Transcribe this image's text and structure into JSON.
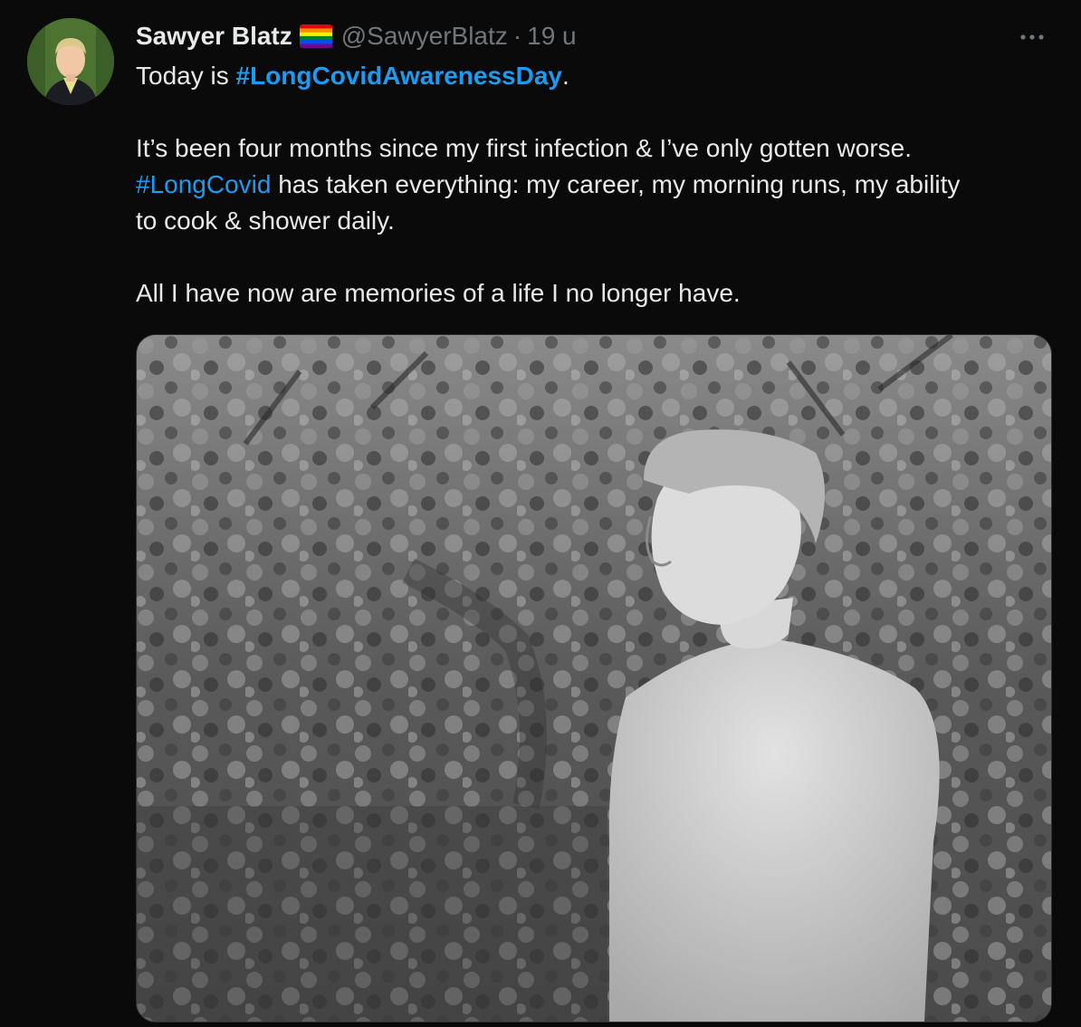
{
  "tweet": {
    "author": {
      "display_name": "Sawyer Blatz",
      "handle": "@SawyerBlatz",
      "flag_icon": "rainbow-flag-icon"
    },
    "separator": "·",
    "time": "19 u",
    "text": {
      "line1_prefix": "Today is ",
      "line1_hashtag": "#LongCovidAwarenessDay",
      "line1_suffix": ".",
      "para2_line1": "It’s been four months since my first infection & I’ve only gotten worse.",
      "para2_hashtag": "#LongCovid",
      "para2_rest": " has taken everything: my career, my morning runs, my ability",
      "para2_line3": "to cook & shower daily.",
      "para3": "All I have now are memories of a life I no longer have."
    },
    "colors": {
      "background": "#0a0a0a",
      "text": "#e7e9ea",
      "muted": "#71767b",
      "link": "#1d9bf0"
    }
  }
}
